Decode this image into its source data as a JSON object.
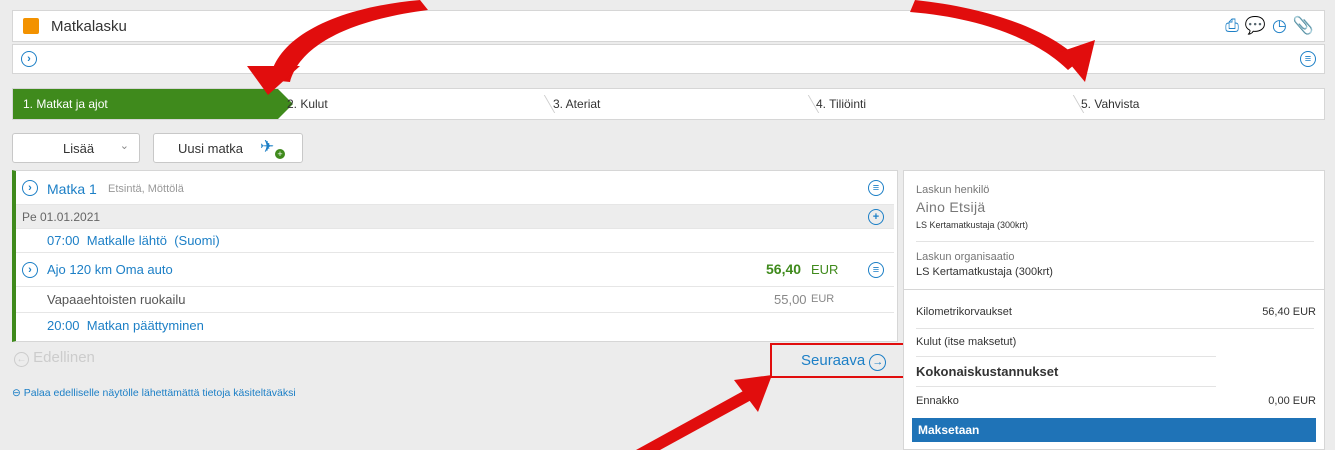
{
  "window": {
    "title": "Matkalasku"
  },
  "steps": [
    {
      "label": "1. Matkat ja ajot"
    },
    {
      "label": "2. Kulut"
    },
    {
      "label": "3. Ateriat"
    },
    {
      "label": "4. Tiliöinti"
    },
    {
      "label": "5. Vahvista"
    }
  ],
  "toolbar": {
    "lisaa": "Lisää",
    "uusi_matka": "Uusi matka"
  },
  "trip": {
    "name": "Matka 1",
    "subtitle": "Etsintä, Möttölä",
    "date": "Pe 01.01.2021",
    "departure": "07:00  Matkalle lähtö  (Suomi)",
    "drive": "Ajo 120 km Oma auto",
    "drive_amount": "56,40",
    "drive_currency": "EUR",
    "meal": "Vapaaehtoisten ruokailu",
    "meal_amount": "55,00",
    "meal_currency": "EUR",
    "end": "20:00  Matkan päättyminen"
  },
  "nav": {
    "previous": "Edellinen",
    "next": "Seuraava",
    "return_link": "Palaa edelliselle näytölle lähettämättä tietoja käsiteltäväksi"
  },
  "summary": {
    "person_label": "Laskun henkilö",
    "person_name": "Aino Etsijä",
    "person_org": "LS Kertamatkustaja (300krt)",
    "org_label": "Laskun organisaatio",
    "org_name": "LS Kertamatkustaja (300krt)",
    "km_label": "Kilometrikorvaukset",
    "km_value": "56,40 EUR",
    "expenses_label": "Kulut (itse maksetut)",
    "total_label": "Kokonaiskustannukset",
    "advance_label": "Ennakko",
    "advance_value": "0,00 EUR",
    "pay_label": "Maksetaan"
  },
  "colors": {
    "accent_green": "#3f8a1c",
    "link_blue": "#1c7fc6",
    "highlight_red": "#e10d0d",
    "pay_bar": "#1f73b7"
  }
}
